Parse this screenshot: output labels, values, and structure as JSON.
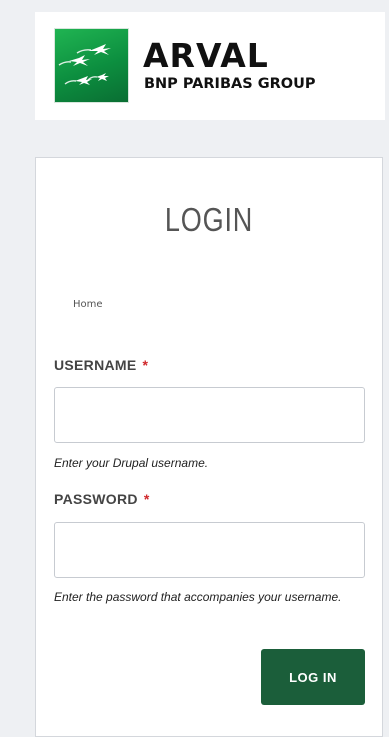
{
  "brand": {
    "name": "ARVAL",
    "group": "BNP PARIBAS GROUP",
    "logo_icon": "bnp-stars-logo-icon",
    "accent_color": "#1b5e3a",
    "logo_green": "#0c8e3f"
  },
  "login": {
    "title": "LOGIN",
    "breadcrumb": "Home",
    "username": {
      "label": "USERNAME",
      "required_marker": "*",
      "value": "",
      "hint": "Enter your Drupal username."
    },
    "password": {
      "label": "PASSWORD",
      "required_marker": "*",
      "value": "",
      "hint": "Enter the password that accompanies your username."
    },
    "submit_label": "LOG IN",
    "required_color": "#d0282c"
  }
}
